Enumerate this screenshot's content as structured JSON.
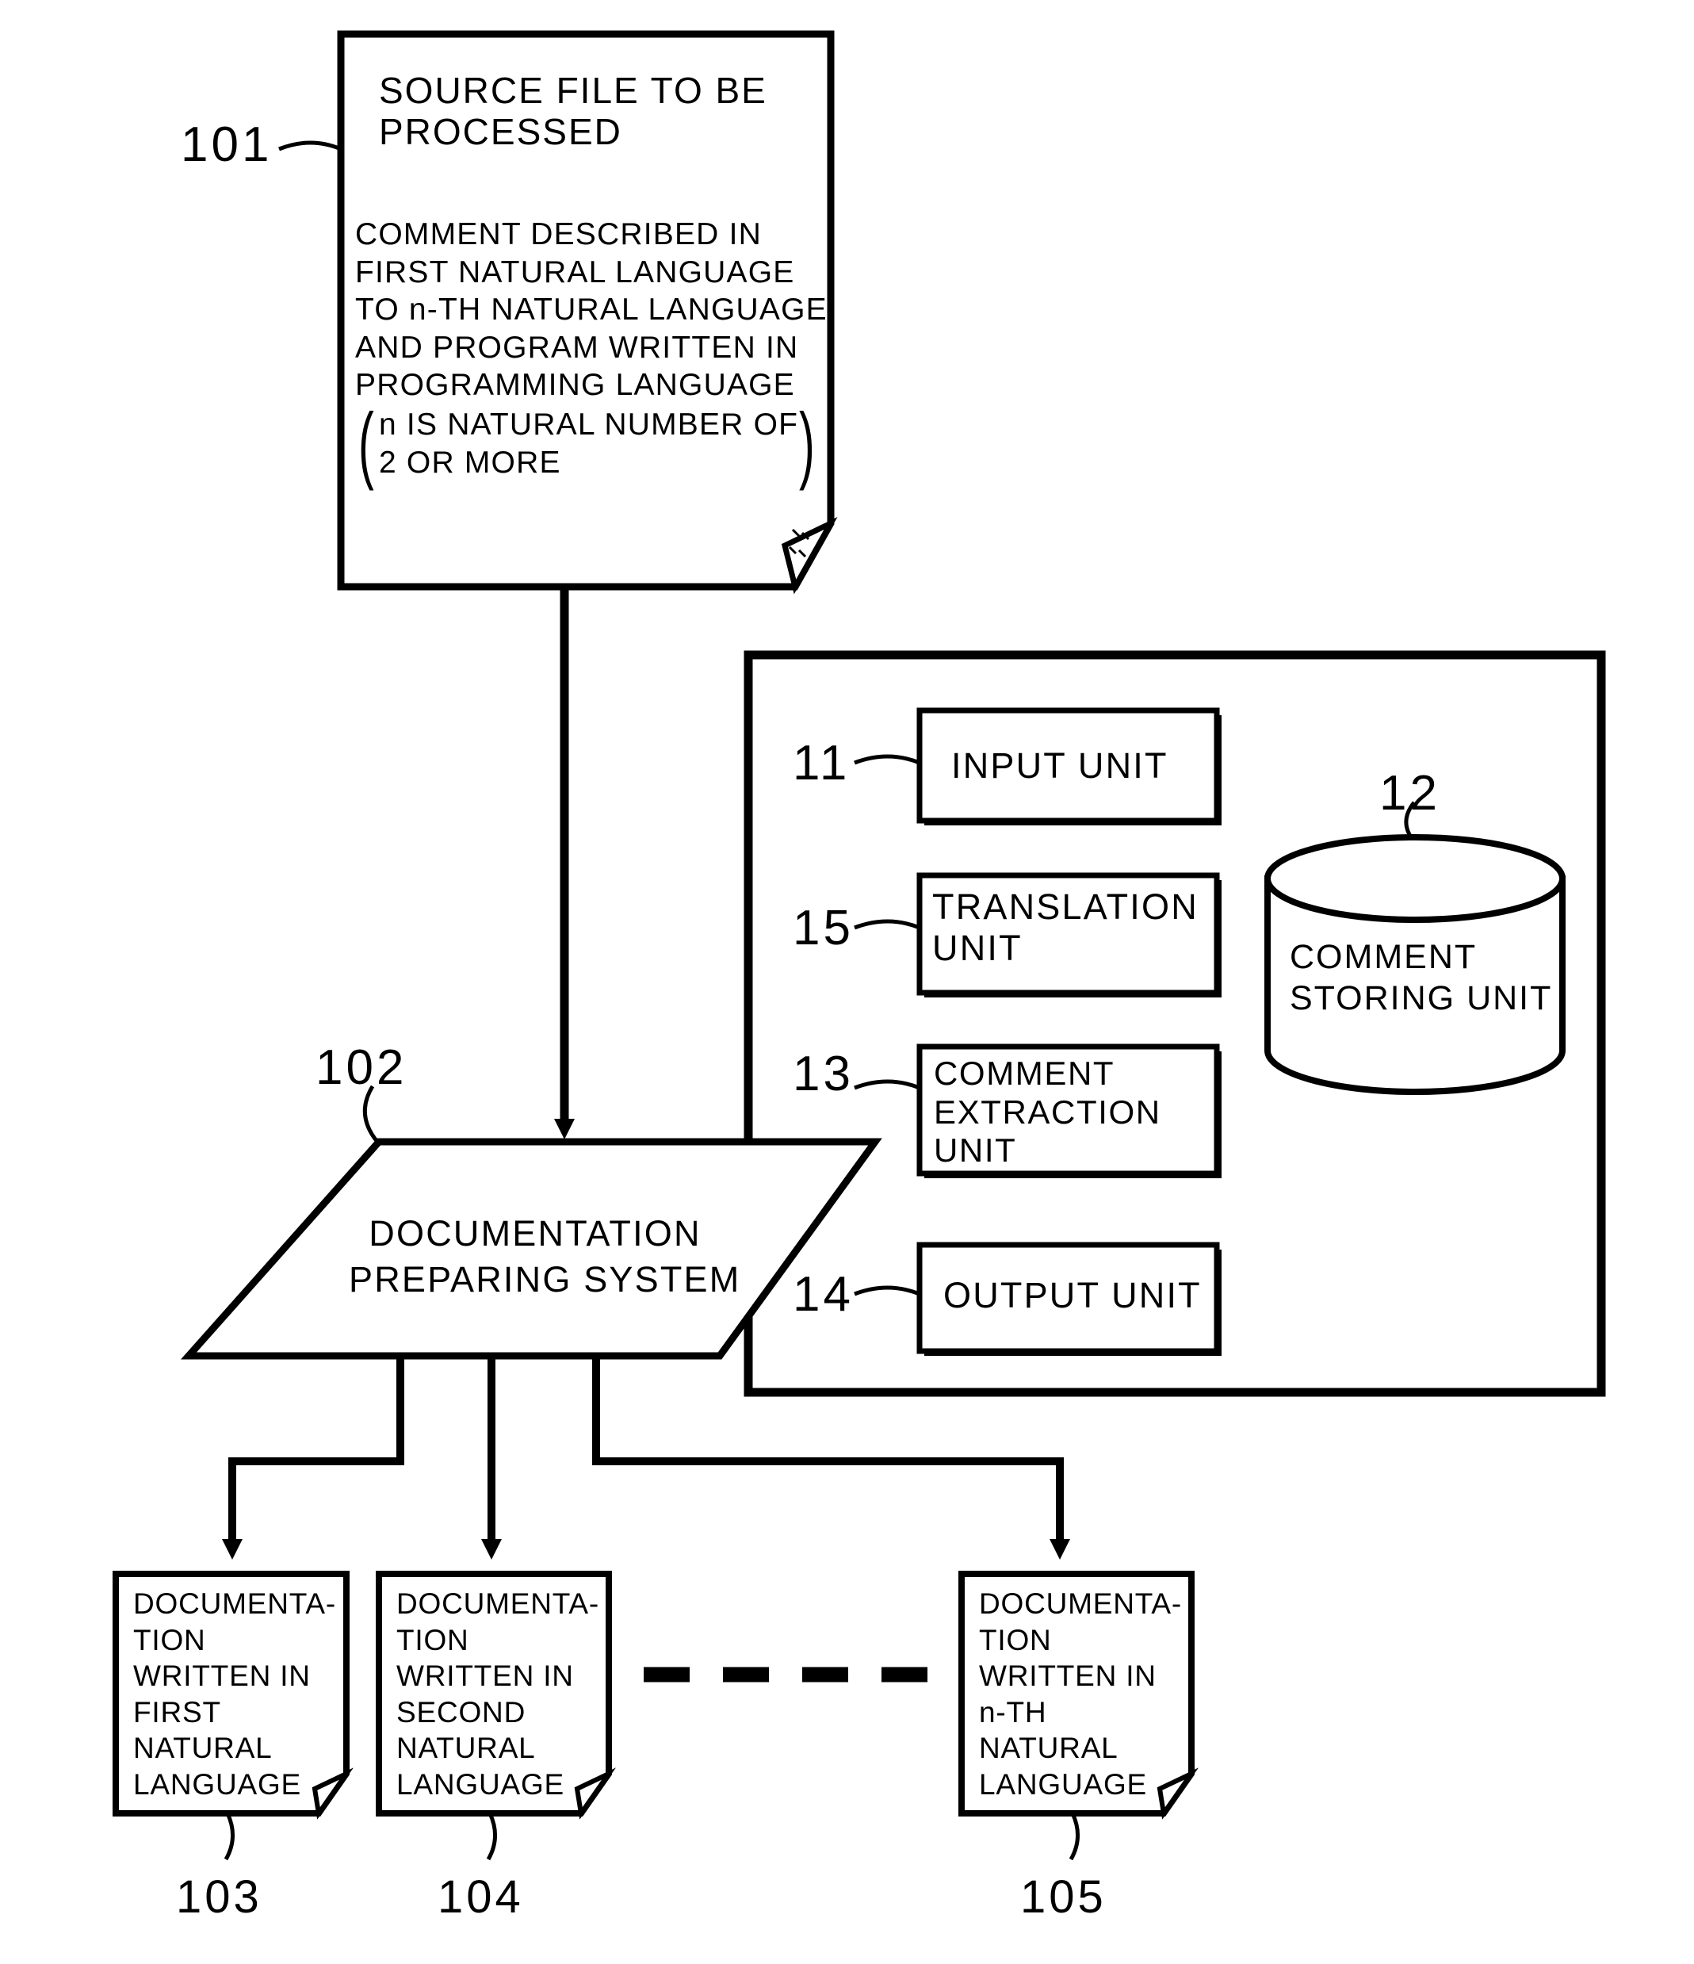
{
  "figure": {
    "type": "patent-block-diagram",
    "source_file": {
      "ref": "101",
      "title": "SOURCE FILE TO BE\nPROCESSED",
      "body": "COMMENT DESCRIBED IN\nFIRST NATURAL LANGUAGE\nTO n-TH NATURAL LANGUAGE\nAND PROGRAM WRITTEN IN\nPROGRAMMING LANGUAGE",
      "note_open_paren": "(",
      "note_close_paren": ")",
      "note": "n IS NATURAL NUMBER OF\n2 OR MORE"
    },
    "system": {
      "ref": "102",
      "label": "DOCUMENTATION\nPREPARING SYSTEM",
      "units": [
        {
          "ref": "11",
          "label": "INPUT UNIT"
        },
        {
          "ref": "15",
          "label": "TRANSLATION\nUNIT"
        },
        {
          "ref": "13",
          "label": "COMMENT\nEXTRACTION\nUNIT"
        },
        {
          "ref": "14",
          "label": "OUTPUT UNIT"
        }
      ],
      "storage": {
        "ref": "12",
        "label": "COMMENT\nSTORING UNIT"
      }
    },
    "outputs": [
      {
        "ref": "103",
        "label": "DOCUMENTA-\nTION\nWRITTEN IN\nFIRST\nNATURAL\nLANGUAGE"
      },
      {
        "ref": "104",
        "label": "DOCUMENTA-\nTION\nWRITTEN IN\nSECOND\nNATURAL\nLANGUAGE"
      },
      {
        "ref": "105",
        "label": "DOCUMENTA-\nTION\nWRITTEN IN\nn-TH\nNATURAL\nLANGUAGE"
      }
    ],
    "ellipsis_connector": "dashed"
  }
}
